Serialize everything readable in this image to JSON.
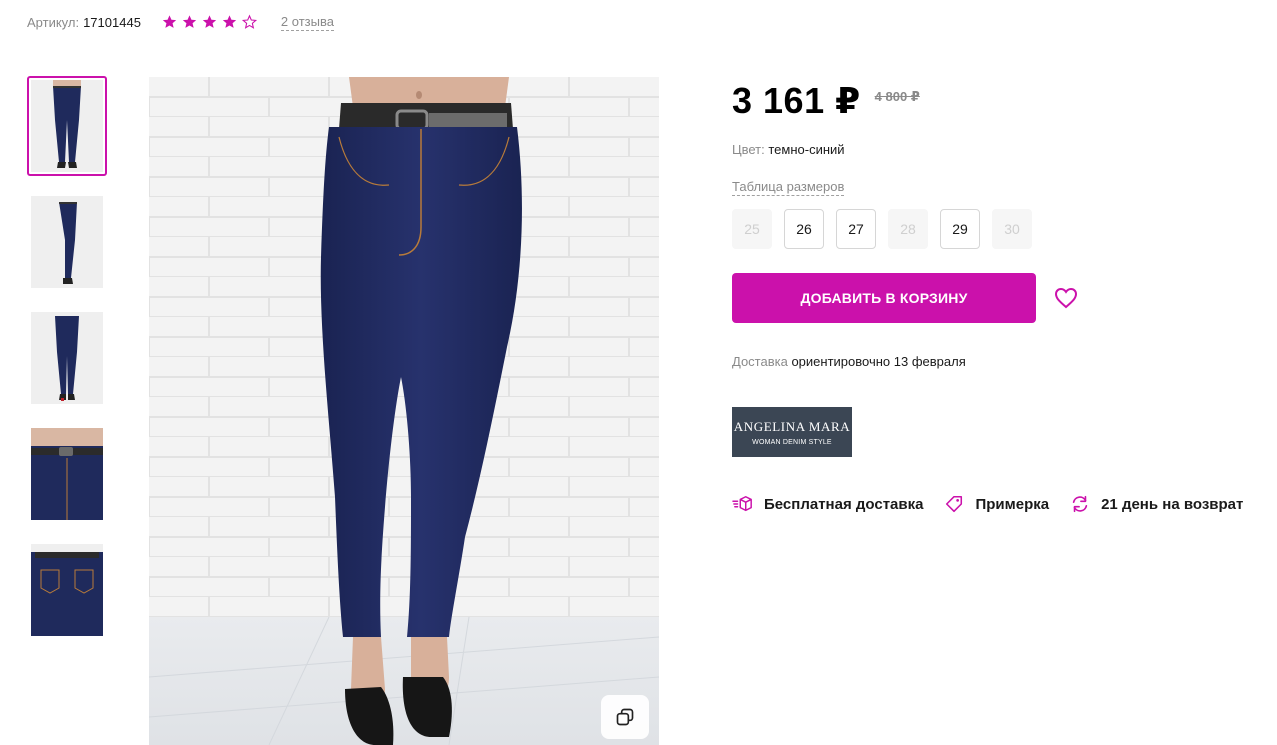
{
  "sku": {
    "label": "Артикул:",
    "value": "17101445"
  },
  "rating": {
    "stars": 4,
    "max": 5,
    "reviews_text": "2 отзыва"
  },
  "gallery": {
    "thumbnails": [
      {
        "icon": "full-front-view",
        "active": true
      },
      {
        "icon": "side-view",
        "active": false
      },
      {
        "icon": "back-view",
        "active": false
      },
      {
        "icon": "waist-detail",
        "active": false
      },
      {
        "icon": "back-pocket-detail",
        "active": false
      }
    ],
    "zoom_icon": "copy-icon"
  },
  "price": {
    "current": "3 161 ₽",
    "old": "4 800 ₽"
  },
  "color": {
    "label": "Цвет:",
    "value": "темно-синий"
  },
  "size_table_link": "Таблица размеров",
  "sizes": [
    {
      "label": "25",
      "available": false
    },
    {
      "label": "26",
      "available": true
    },
    {
      "label": "27",
      "available": true
    },
    {
      "label": "28",
      "available": false
    },
    {
      "label": "29",
      "available": true
    },
    {
      "label": "30",
      "available": false
    }
  ],
  "add_to_cart": "ДОБАВИТЬ В КОРЗИНУ",
  "delivery": {
    "label": "Доставка",
    "value": "ориентировочно 13 февраля"
  },
  "brand": {
    "name": "ANGELINA MARA",
    "tagline": "WOMAN DENIM STYLE"
  },
  "perks": [
    {
      "icon": "delivery-box-icon",
      "label": "Бесплатная доставка"
    },
    {
      "icon": "tag-icon",
      "label": "Примерка"
    },
    {
      "icon": "return-arrows-icon",
      "label": "21 день на возврат"
    }
  ],
  "colors": {
    "accent": "#cb11ab",
    "jeans": "#1f2a5c",
    "brand_bg": "#3b4654"
  }
}
